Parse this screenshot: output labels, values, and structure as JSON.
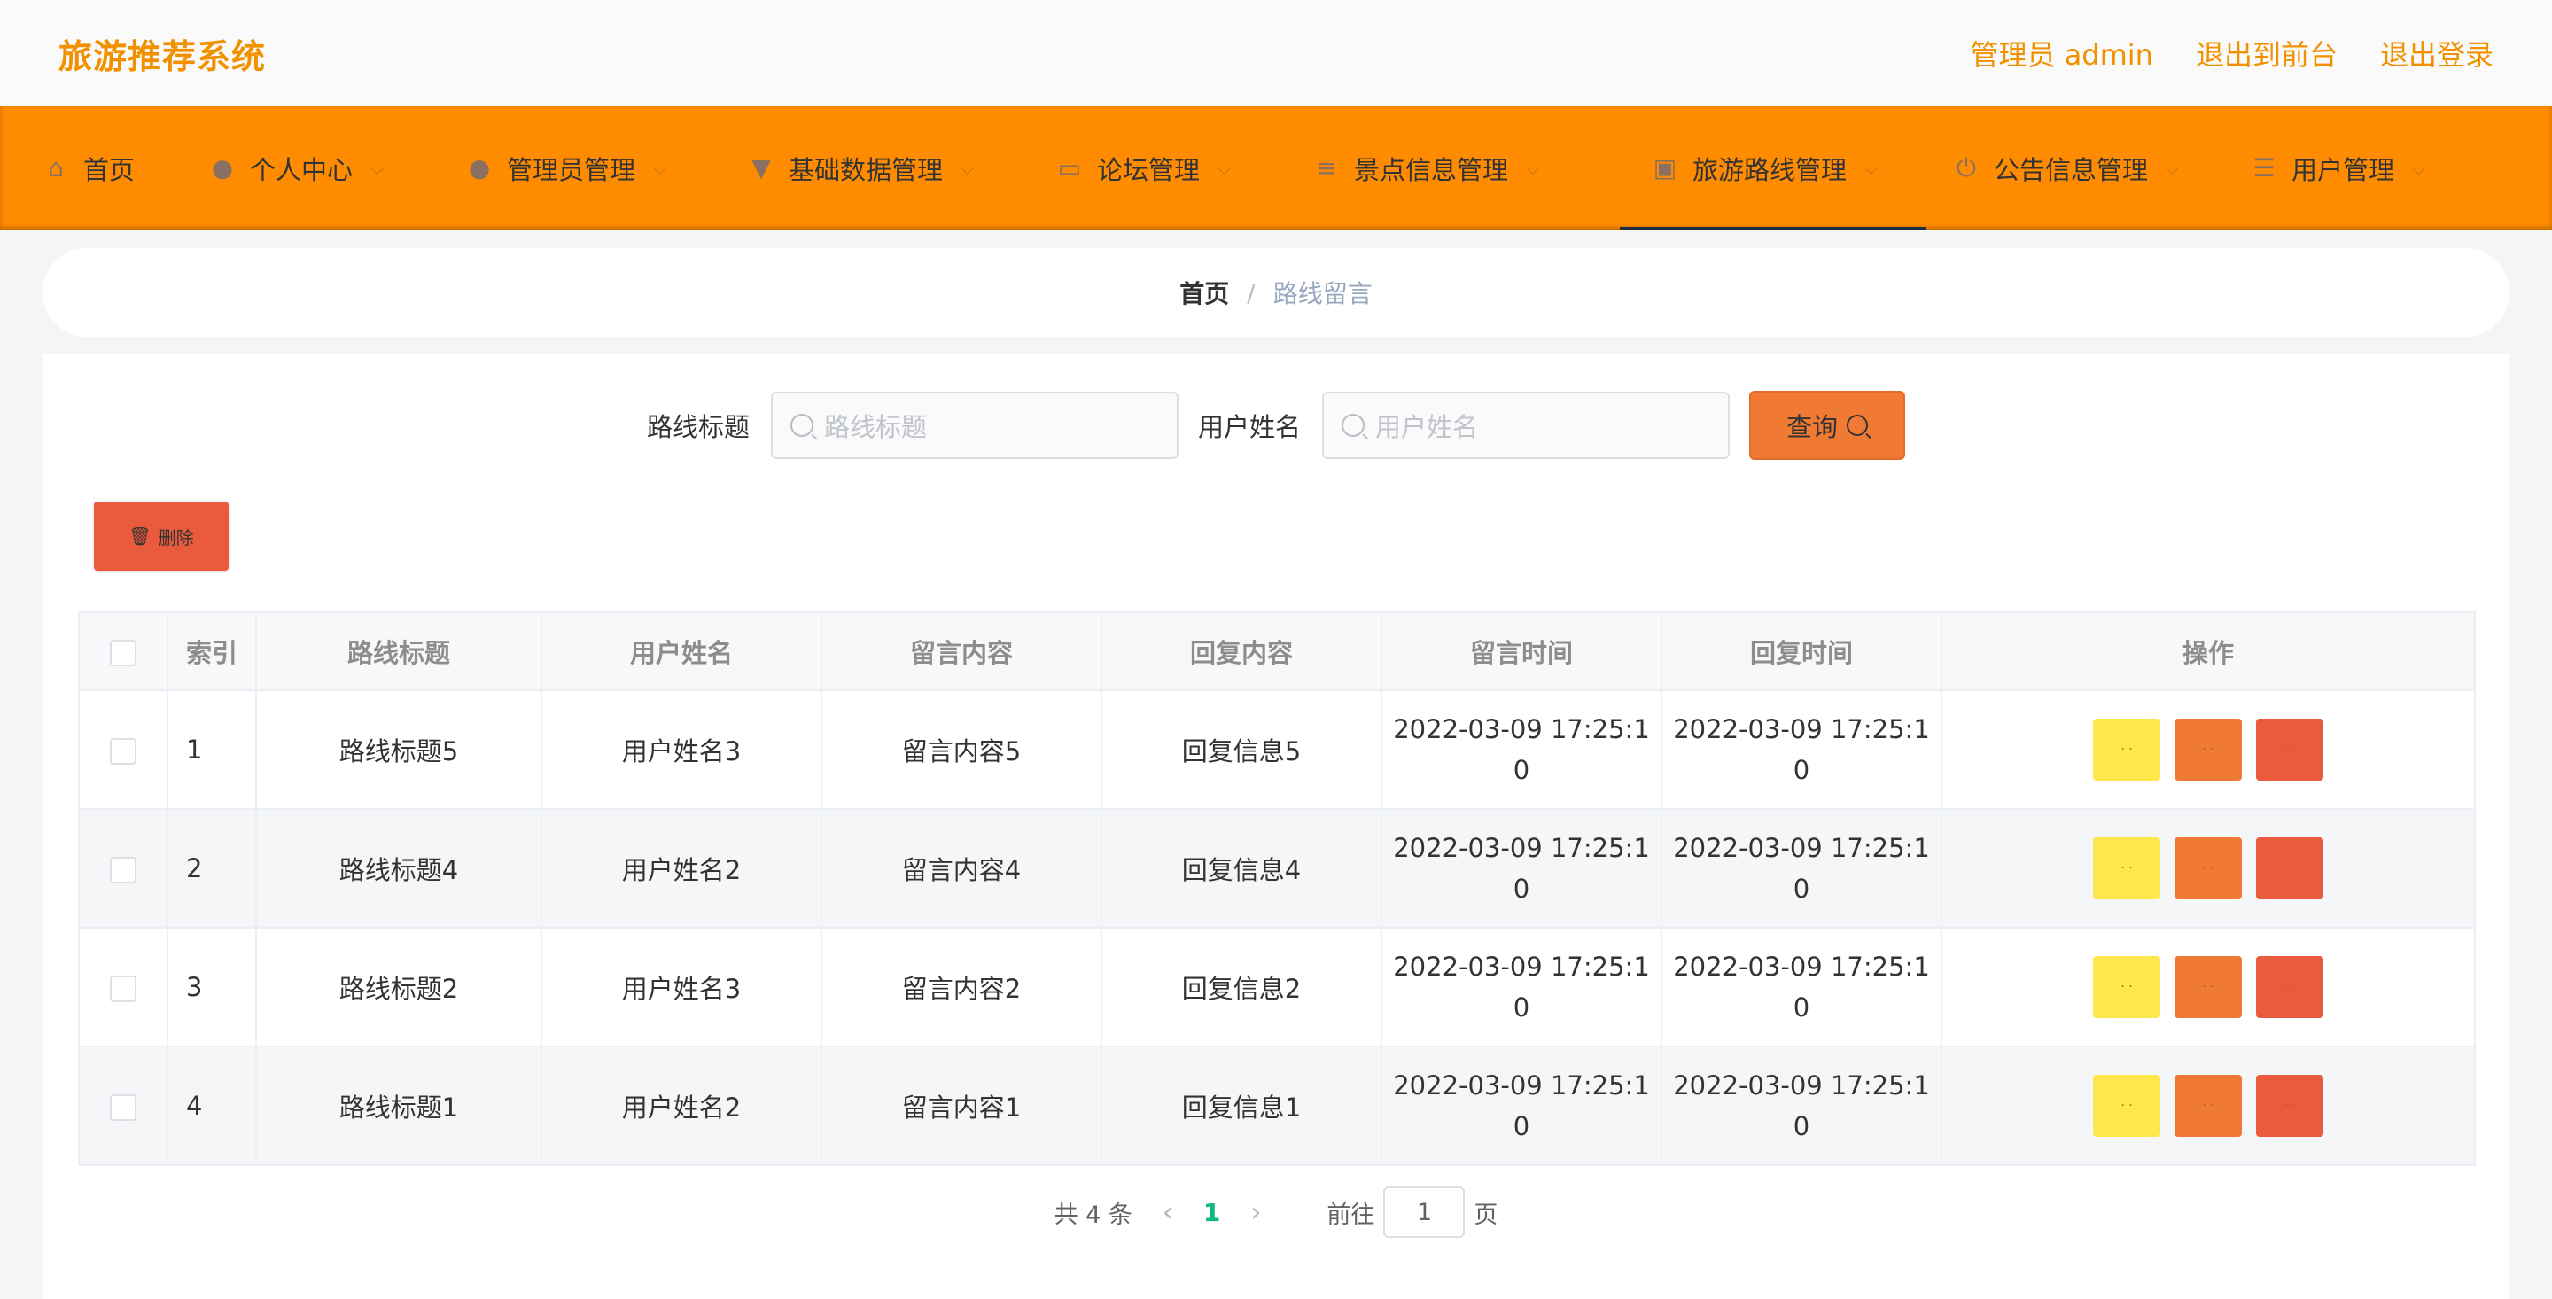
{
  "header": {
    "brand": "旅游推荐系统",
    "actions": [
      "管理员 admin",
      "退出到前台",
      "退出登录"
    ]
  },
  "nav": {
    "items": [
      {
        "label": "首页",
        "icon": "home-icon",
        "has_dropdown": false
      },
      {
        "label": "个人中心",
        "icon": "user-icon",
        "has_dropdown": true
      },
      {
        "label": "管理员管理",
        "icon": "admin-icon",
        "has_dropdown": true
      },
      {
        "label": "基础数据管理",
        "icon": "data-icon",
        "has_dropdown": true
      },
      {
        "label": "论坛管理",
        "icon": "forum-icon",
        "has_dropdown": true
      },
      {
        "label": "景点信息管理",
        "icon": "list-icon",
        "has_dropdown": true
      },
      {
        "label": "旅游路线管理",
        "icon": "route-icon",
        "has_dropdown": true,
        "active": true
      },
      {
        "label": "公告信息管理",
        "icon": "power-icon",
        "has_dropdown": true
      },
      {
        "label": "用户管理",
        "icon": "sliders-icon",
        "has_dropdown": true
      }
    ]
  },
  "breadcrumb": {
    "home": "首页",
    "separator": "/",
    "current": "路线留言"
  },
  "search": {
    "title_label": "路线标题",
    "title_placeholder": "路线标题",
    "user_label": "用户姓名",
    "user_placeholder": "用户姓名",
    "query_label": "查询"
  },
  "toolbar": {
    "delete_label": "删除"
  },
  "table": {
    "headers": [
      "索引",
      "路线标题",
      "用户姓名",
      "留言内容",
      "回复内容",
      "留言时间",
      "回复时间",
      "操作"
    ],
    "rows": [
      {
        "index": "1",
        "title": "路线标题5",
        "user": "用户姓名3",
        "content": "留言内容5",
        "reply": "回复信息5",
        "msg_time_a": "2022-03-09 17:25:1",
        "msg_time_b": "0",
        "reply_time_a": "2022-03-09 17:25:1",
        "reply_time_b": "0"
      },
      {
        "index": "2",
        "title": "路线标题4",
        "user": "用户姓名2",
        "content": "留言内容4",
        "reply": "回复信息4",
        "msg_time_a": "2022-03-09 17:25:1",
        "msg_time_b": "0",
        "reply_time_a": "2022-03-09 17:25:1",
        "reply_time_b": "0"
      },
      {
        "index": "3",
        "title": "路线标题2",
        "user": "用户姓名3",
        "content": "留言内容2",
        "reply": "回复信息2",
        "msg_time_a": "2022-03-09 17:25:1",
        "msg_time_b": "0",
        "reply_time_a": "2022-03-09 17:25:1",
        "reply_time_b": "0"
      },
      {
        "index": "4",
        "title": "路线标题1",
        "user": "用户姓名2",
        "content": "留言内容1",
        "reply": "回复信息1",
        "msg_time_a": "2022-03-09 17:25:1",
        "msg_time_b": "0",
        "reply_time_a": "2022-03-09 17:25:1",
        "reply_time_b": "0"
      }
    ]
  },
  "pager": {
    "total_label": "共 4 条",
    "current_page": "1",
    "goto_label": "前往",
    "page_value": "1",
    "page_suffix": "页"
  },
  "colors": {
    "brand": "#f29100",
    "nav_bg": "#ff8c00",
    "btn_yellow": "#fde74c",
    "btn_orange": "#f07a33",
    "btn_red": "#ea5a3d",
    "page_active": "#10b981"
  }
}
